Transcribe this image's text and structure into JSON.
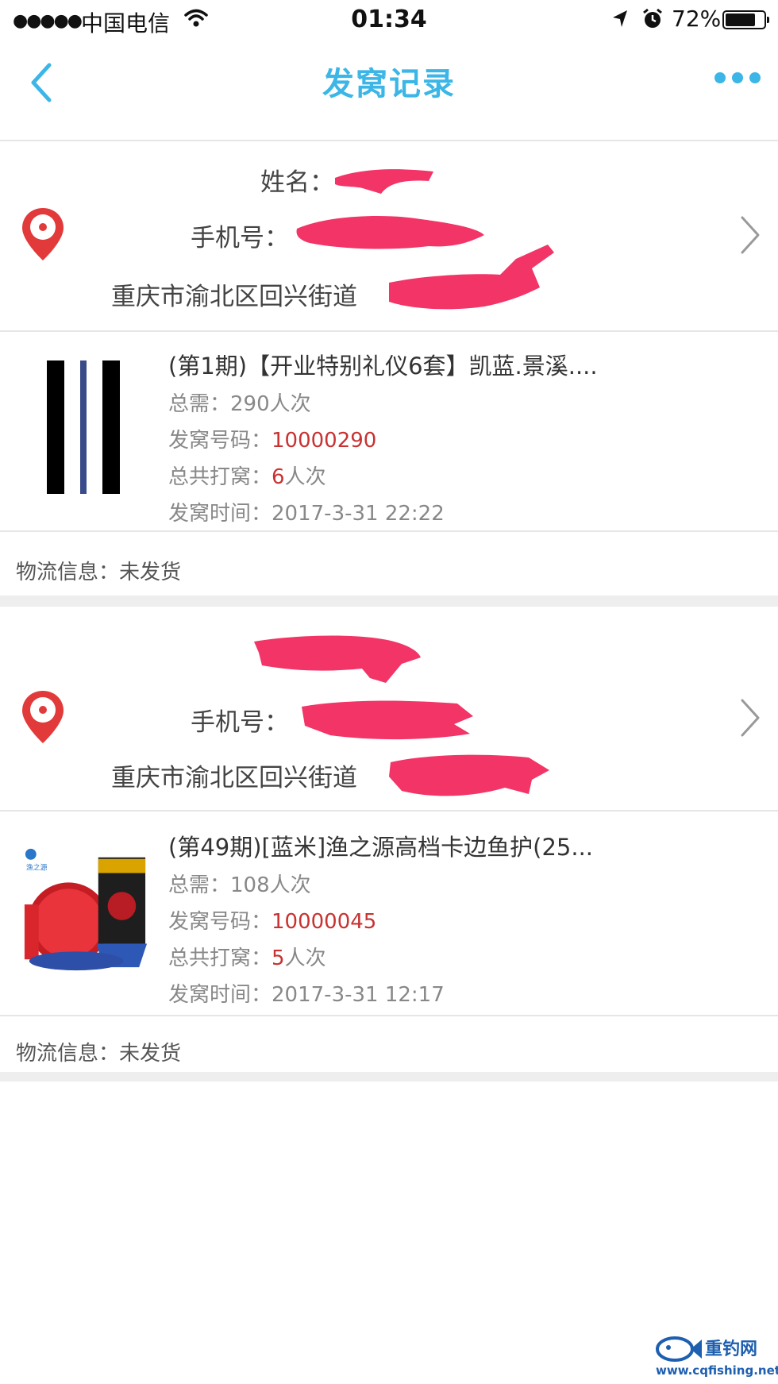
{
  "status_bar": {
    "signal_dots": "●●●●●",
    "carrier": "中国电信",
    "time": "01:34",
    "battery_percent": "72%",
    "battery_level": 0.72,
    "icons": [
      "wifi-icon",
      "location-arrow-icon",
      "alarm-icon",
      "battery-icon"
    ]
  },
  "nav": {
    "title": "发窝记录",
    "back_icon": "chevron-left-icon",
    "more_icon": "more-dots-icon",
    "accent_color": "#3cb6e6"
  },
  "records": [
    {
      "address": {
        "name_label": "姓名：",
        "phone_label": "手机号：",
        "street": "重庆市渝北区回兴街道"
      },
      "product": {
        "title": "(第1期)【开业特别礼仪6套】凯蓝.景溪....",
        "total_label": "总需：",
        "total_value": "290人次",
        "code_label": "发窝号码：",
        "code_value": "10000290",
        "hits_label": "总共打窝：",
        "hits_count": "6",
        "hits_unit": "人次",
        "time_label": "发窝时间：",
        "time_value": "2017-3-31 22:22"
      },
      "logistics": "物流信息：未发货"
    },
    {
      "address": {
        "phone_label": "手机号：",
        "street": "重庆市渝北区回兴街道"
      },
      "product": {
        "title": "(第49期)[蓝米]渔之源高档卡边鱼护(25...",
        "total_label": "总需：",
        "total_value": "108人次",
        "code_label": "发窝号码：",
        "code_value": "10000045",
        "hits_label": "总共打窝：",
        "hits_count": "5",
        "hits_unit": "人次",
        "time_label": "发窝时间：",
        "time_value": "2017-3-31 12:17"
      },
      "logistics": "物流信息：未发货"
    }
  ],
  "watermark": {
    "brand": "重钓网",
    "url": "www.cqfishing.net"
  },
  "colors": {
    "highlight_red": "#c83232",
    "pin_red": "#e23a3a",
    "redaction_pink": "#f23466"
  }
}
